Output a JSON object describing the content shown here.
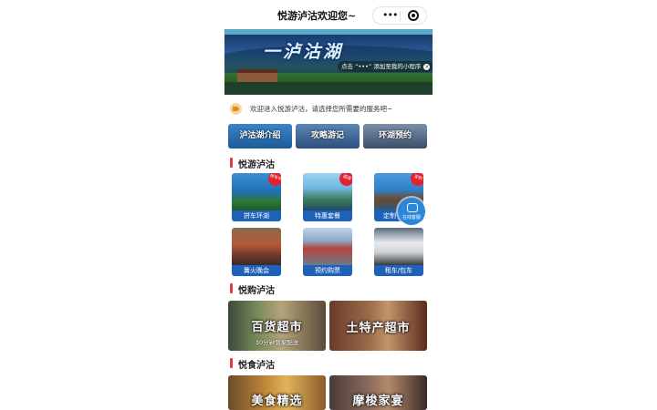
{
  "header": {
    "title": "悦游泸沽欢迎您~"
  },
  "banner": {
    "headline": "一泸沽湖",
    "tooltip": "点击 “•••” 添加至我的小程序"
  },
  "notice": {
    "text": "欢迎进入悦游泸沽，请选择您所需要的服务吧~"
  },
  "tabs": [
    {
      "label": "泸沽湖介绍"
    },
    {
      "label": "攻略游记"
    },
    {
      "label": "环湖预约"
    }
  ],
  "sections": {
    "travel": "悦游泸沽",
    "shopping": "悦购泸沽",
    "food": "悦食泸沽"
  },
  "travel_items": [
    {
      "label": "拼车环湖",
      "badge": "拼车中"
    },
    {
      "label": "特惠套餐",
      "badge": "超值"
    },
    {
      "label": "定制",
      "badge": "定制"
    },
    {
      "label": "篝火晚会",
      "badge": ""
    },
    {
      "label": "预约购票",
      "badge": ""
    },
    {
      "label": "租车/包车",
      "badge": ""
    }
  ],
  "float_button": {
    "label": "在线客服"
  },
  "shopping_items": [
    {
      "title": "百货超市",
      "subtitle": "30分钟到家配送"
    },
    {
      "title": "土特产超市",
      "subtitle": ""
    }
  ],
  "food_items": [
    {
      "title": "美食精选"
    },
    {
      "title": "摩梭家宴"
    }
  ],
  "colors": {
    "accent": "#e43a48",
    "tile_caption": "#1d62b8"
  }
}
